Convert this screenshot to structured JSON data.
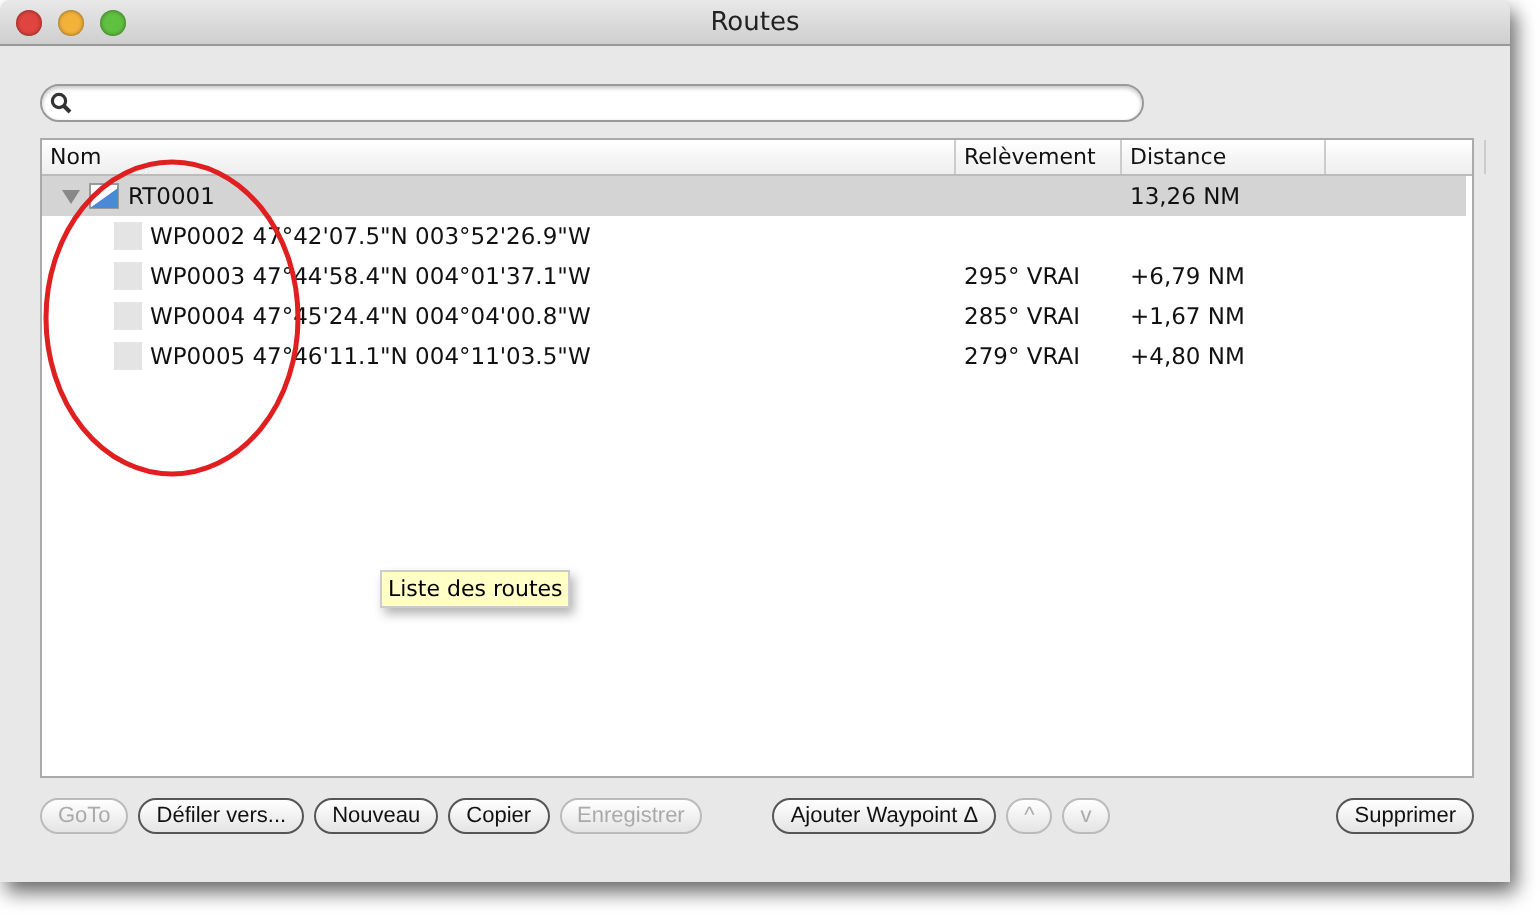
{
  "window": {
    "title": "Routes"
  },
  "table": {
    "columns": [
      "Nom",
      "Relèvement",
      "Distance"
    ],
    "rows": [
      {
        "name": "RT0001",
        "distance": "13,26 NM",
        "selected": true,
        "expanded": true,
        "children": [
          {
            "name": "WP0002 47°42'07.5\"N 003°52'26.9\"W",
            "selected": false
          },
          {
            "name": "WP0003 47°44'58.4\"N 004°01'37.1\"W",
            "bearing": "295° VRAI",
            "distance": "+6,79 NM",
            "selected": false
          },
          {
            "name": "WP0004 47°45'24.4\"N 004°04'00.8\"W",
            "bearing": "285° VRAI",
            "distance": "+1,67 NM",
            "selected": false
          },
          {
            "name": "WP0005 47°46'11.1\"N 004°11'03.5\"W",
            "bearing": "279° VRAI",
            "distance": "+4,80 NM",
            "selected": false
          }
        ]
      }
    ]
  },
  "tooltip": "Liste des routes",
  "buttons": [
    {
      "label": "GoTo",
      "disabled": true
    },
    {
      "label": "Défiler vers...",
      "disabled": false
    },
    {
      "label": "Nouveau",
      "disabled": false
    },
    {
      "label": "Copier",
      "disabled": false
    },
    {
      "label": "Enregistrer",
      "disabled": true
    },
    {
      "label": "Ajouter Waypoint Δ",
      "disabled": false
    },
    {
      "label": "^",
      "disabled": true
    },
    {
      "label": "v",
      "disabled": true
    },
    {
      "label": "Supprimer",
      "disabled": false
    }
  ]
}
